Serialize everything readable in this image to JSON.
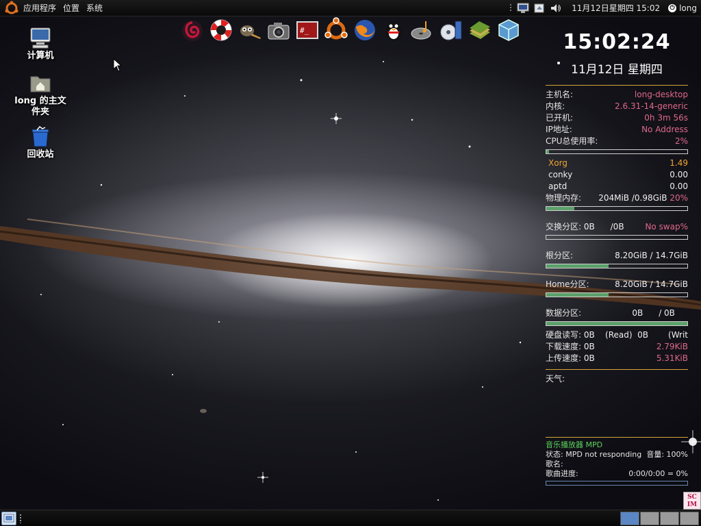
{
  "top_panel": {
    "menus": [
      "应用程序",
      "位置",
      "系统"
    ],
    "clock": "11月12日星期四 15:02",
    "user": "long"
  },
  "dock": {
    "icons": [
      "debian-swirl-icon",
      "help-lifebuoy-icon",
      "gimp-icon",
      "camera-icon",
      "terminal-icon",
      "ubuntu-icon",
      "firefox-icon",
      "qq-penguin-icon",
      "music-disc-icon",
      "media-player-icon",
      "books-icon",
      "virtualbox-icon"
    ]
  },
  "desktop": {
    "computer": "计算机",
    "home_line1": "long 的主文",
    "home_line2": "件夹",
    "trash": "回收站"
  },
  "conky": {
    "time": "15:02:24",
    "date": "11月12日 星期四",
    "hostname_label": "主机名:",
    "hostname": "long-desktop",
    "kernel_label": "内核:",
    "kernel": "2.6.31-14-generic",
    "uptime_label": "已开机:",
    "uptime": "0h 3m 56s",
    "ip_label": "IP地址:",
    "ip": "No Address",
    "cpu_label": "CPU总使用率:",
    "cpu": "2%",
    "cpu_fraction": 0.02,
    "processes": [
      {
        "name": "Xorg",
        "value": "1.49"
      },
      {
        "name": "conky",
        "value": "0.00"
      },
      {
        "name": "aptd",
        "value": "0.00"
      }
    ],
    "mem_label": "物理内存:",
    "mem_used": "204MiB",
    "mem_total": "/0.98GiB",
    "mem_pct": "20%",
    "mem_fraction": 0.2,
    "swap_label": "交换分区:",
    "swap_used": "0B",
    "swap_total": "/0B",
    "swap_status": "No swap%",
    "swap_fraction": 0,
    "root_label": "根分区:",
    "root_value": "8.20GiB / 14.7GiB",
    "root_fraction": 0.44,
    "home_label": "Home分区:",
    "home_value": "8.20GiB / 14.7GiB",
    "home_fraction": 0.44,
    "data_label": "数据分区:",
    "data_used": "0B",
    "data_total": "/ 0B",
    "data_fraction": 1,
    "disk_label": "硬盘读写:",
    "disk_read": "0B",
    "disk_read_label": "(Read)",
    "disk_write": "0B",
    "disk_write_label": "(Writ",
    "down_label": "下载速度:",
    "down_value": "0B",
    "down_total": "2.79KiB",
    "up_label": "上传速度:",
    "up_value": "0B",
    "up_total": "5.31KiB",
    "weather_label": "天气:"
  },
  "mpd": {
    "title": "音乐播放器 MPD",
    "status": "状态: MPD not responding",
    "volume": "音量: 100%",
    "song_label": "歌名:",
    "progress_label": "歌曲进度:",
    "progress_value": "0:00/0:00 = 0%",
    "progress_fraction": 0
  },
  "bottom_panel": {
    "workspaces": 4,
    "active_workspace": 1,
    "scim_label": "SC IM"
  },
  "colors": {
    "accent_pink": "#e0688a",
    "accent_orange": "#f2a533",
    "bar_fill": "#5ca06a",
    "separator": "#d8a63a",
    "mpd_green": "#5ed35e",
    "workspace_active": "#5a86c4"
  }
}
